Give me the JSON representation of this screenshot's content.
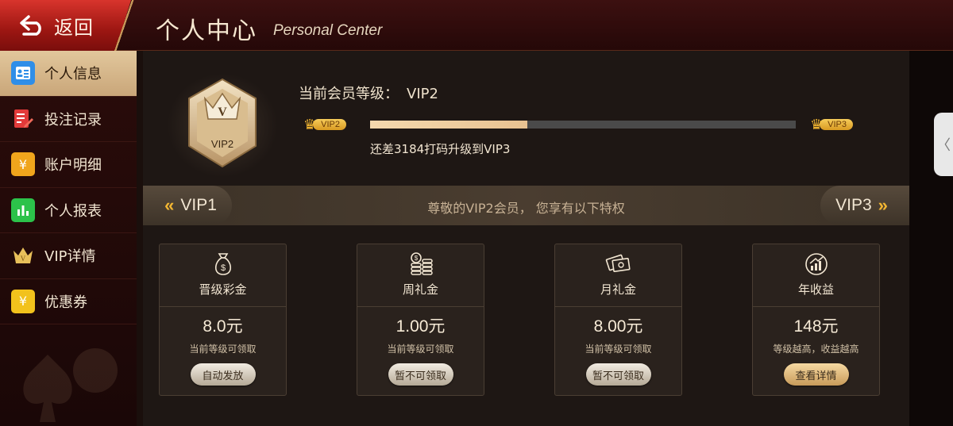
{
  "header": {
    "back_label": "返回",
    "title": "个人中心",
    "subtitle": "Personal Center"
  },
  "sidebar": {
    "items": [
      {
        "label": "个人信息",
        "icon": "profile-card-icon",
        "color": "#2f8ee8",
        "active": true
      },
      {
        "label": "投注记录",
        "icon": "bet-record-icon",
        "color": "#e23a3a",
        "active": false
      },
      {
        "label": "账户明细",
        "icon": "wallet-icon",
        "color": "#f0a51c",
        "active": false
      },
      {
        "label": "个人报表",
        "icon": "report-chart-icon",
        "color": "#2cc24a",
        "active": false
      },
      {
        "label": "VIP详情",
        "icon": "vip-crown-icon",
        "color": "#e8c05a",
        "active": false
      },
      {
        "label": "优惠券",
        "icon": "coupon-icon",
        "color": "#f2c21c",
        "active": false
      }
    ]
  },
  "vip": {
    "badge_letter": "V",
    "badge_label": "VIP2",
    "level_label": "当前会员等级：",
    "level_value": "VIP2",
    "current_tag": "VIP2",
    "next_tag": "VIP3",
    "progress_fraction": 0.37,
    "upgrade_hint": "还差3184打码升级到VIP3"
  },
  "banner": {
    "prev_label": "VIP1",
    "next_label": "VIP3",
    "text": "尊敬的VIP2会员， 您享有以下特权"
  },
  "cards": [
    {
      "title": "晋级彩金",
      "icon": "money-bag-icon",
      "amount": "8.0元",
      "desc": "当前等级可领取",
      "button": "自动发放",
      "button_style": "silver"
    },
    {
      "title": "周礼金",
      "icon": "coin-stack-icon",
      "amount": "1.00元",
      "desc": "当前等级可领取",
      "button": "暂不可领取",
      "button_style": "silver"
    },
    {
      "title": "月礼金",
      "icon": "cash-bills-icon",
      "amount": "8.00元",
      "desc": "当前等级可领取",
      "button": "暂不可领取",
      "button_style": "silver"
    },
    {
      "title": "年收益",
      "icon": "growth-chart-icon",
      "amount": "148元",
      "desc": "等级越高，收益越高",
      "button": "查看详情",
      "button_style": "gold"
    }
  ],
  "colors": {
    "accent_gold": "#f2b632",
    "header_red": "#9c1612",
    "progress_fill": "#f4d8ae"
  },
  "side_handle_glyph": "〈"
}
